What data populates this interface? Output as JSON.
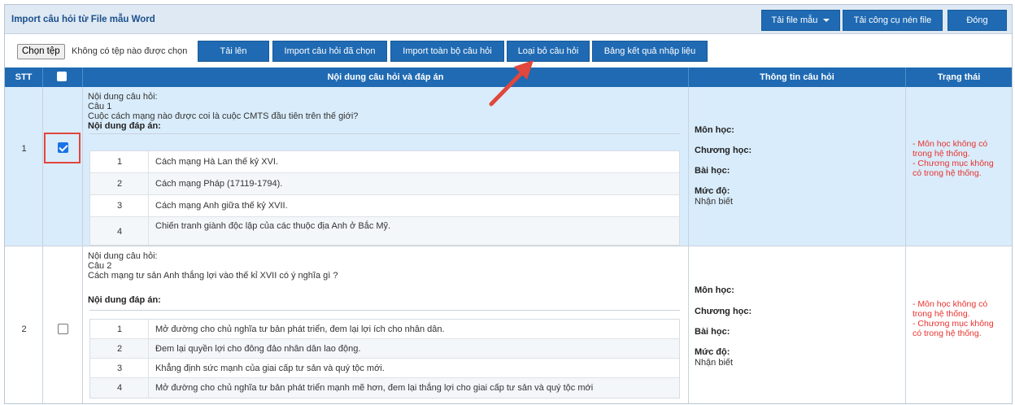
{
  "header": {
    "title": "Import câu hỏi từ File mẫu Word",
    "btn_template": "Tải file mẫu",
    "btn_compress": "Tải công cụ nén file",
    "btn_close": "Đóng"
  },
  "toolbar": {
    "choose_file": "Chọn tệp",
    "no_file": "Không có tệp nào được chọn",
    "upload": "Tải lên",
    "import_selected": "Import câu hỏi đã chọn",
    "import_all": "Import toàn bộ câu hỏi",
    "remove": "Loại bỏ câu hỏi",
    "results": "Bảng kết quả nhập liệu"
  },
  "table": {
    "headers": {
      "stt": "STT",
      "content": "Nội dung câu hỏi và đáp án",
      "info": "Thông tin câu hỏi",
      "status": "Trạng thái"
    },
    "rows": [
      {
        "stt": "1",
        "checked": true,
        "q_label": "Nội dung câu hỏi:",
        "q_number": "Câu  1",
        "q_text": "Cuộc cách mạng nào được coi là cuộc CMTS đầu tiên trên thế giới?",
        "a_label": "Nội dung đáp án:",
        "answers": [
          {
            "n": "1",
            "text": "Cách mạng Hà Lan thế kỷ XVI."
          },
          {
            "n": "2",
            "text": "Cách mạng Pháp (17119-1794)."
          },
          {
            "n": "3",
            "text": "Cách mạng Anh giữa thế kỷ XVII."
          },
          {
            "n": "4",
            "text": "Chiến tranh giành độc lập của các thuộc địa Anh ở Bắc Mỹ."
          }
        ],
        "info": {
          "subject": "Môn học:",
          "chapter": "Chương học:",
          "lesson": "Bài học:",
          "level": "Mức độ:",
          "level_value": "Nhận biết"
        },
        "status": [
          "- Môn học không có",
          "trong hệ thống.",
          "- Chương mục không",
          "có trong hệ thống."
        ]
      },
      {
        "stt": "2",
        "checked": false,
        "q_label": "Nội dung câu hỏi:",
        "q_number": "Câu  2",
        "q_text": "Cách mạng tư sản Anh thắng lợi vào thế kỉ XVII có ý nghĩa gì ?",
        "a_label": "Nội dung đáp án:",
        "answers": [
          {
            "n": "1",
            "text": "Mở đường cho chủ nghĩa tư bản phát triển, đem lại lợi ích cho nhân dân."
          },
          {
            "n": "2",
            "text": "Đem lại quyền lợi cho đông đảo nhân dân lao động."
          },
          {
            "n": "3",
            "text": "Khẳng định sức mạnh của giai cấp tư sản và quý tộc mới."
          },
          {
            "n": "4",
            "text": "Mở đường cho chủ nghĩa tư bản phát triển mạnh mẽ hơn, đem lại thắng lợi cho giai cấp tư sản và quý tộc mới"
          }
        ],
        "info": {
          "subject": "Môn học:",
          "chapter": "Chương học:",
          "lesson": "Bài học:",
          "level": "Mức độ:",
          "level_value": "Nhận biết"
        },
        "status": [
          "- Môn học không có",
          "trong hệ thống.",
          "- Chương mục không",
          "có trong hệ thống."
        ]
      }
    ]
  },
  "colors": {
    "primary": "#1f6ab3",
    "selected_row": "#d9ecfb",
    "error": "#e8312d",
    "annotation": "#e0473d"
  }
}
